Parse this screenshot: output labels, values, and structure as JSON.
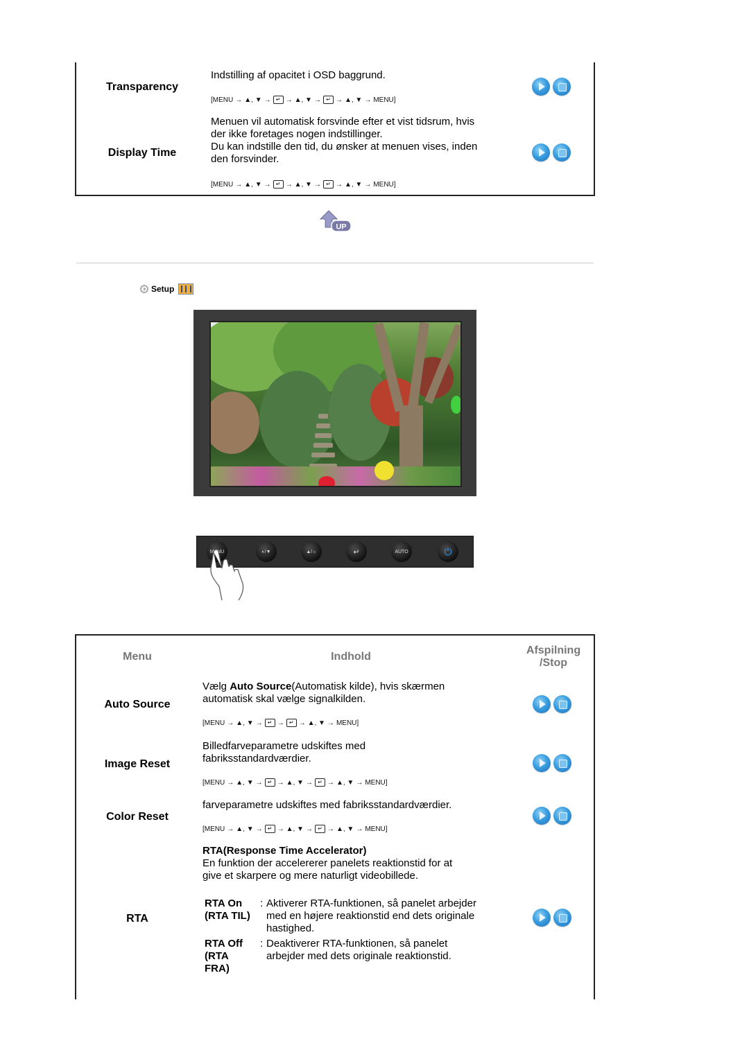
{
  "top_table": {
    "rows": [
      {
        "menu": "Transparency",
        "description": [
          "Indstilling af opacitet i OSD baggrund."
        ],
        "path": [
          "[MENU",
          "→",
          "▲, ▼",
          "→",
          "ENTER",
          "→",
          "▲, ▼",
          "→",
          "ENTER",
          "→",
          "▲, ▼",
          "→",
          "MENU]"
        ],
        "play_icon": "play-icon",
        "stop_icon": "stop-icon"
      },
      {
        "menu": "Display Time",
        "description": [
          "Menuen vil automatisk forsvinde efter et vist tidsrum, hvis",
          "der ikke foretages nogen indstillinger.",
          "Du kan indstille den tid, du ønsker at menuen vises, inden",
          "den forsvinder."
        ],
        "path": [
          "[MENU",
          "→",
          "▲, ▼",
          "→",
          "ENTER",
          "→",
          "▲, ▼",
          "→",
          "ENTER",
          "→",
          "▲, ▼",
          "→",
          "MENU]"
        ],
        "play_icon": "play-icon",
        "stop_icon": "stop-icon"
      }
    ]
  },
  "up_button": {
    "label": "UP",
    "icon": "up-arrow-icon"
  },
  "section": {
    "title": "Setup",
    "bullet_icon": "circle-arrow-icon",
    "section_icon": "equalizer-icon"
  },
  "monitor": {
    "image_alt": "garden-photo-with-pagoda"
  },
  "control_bar": {
    "buttons": [
      {
        "name": "menu",
        "label": "MENU"
      },
      {
        "name": "magic-down",
        "label": "◐/▼"
      },
      {
        "name": "up-brightness",
        "label": "▲/☼"
      },
      {
        "name": "enter",
        "label": "↵"
      },
      {
        "name": "auto",
        "label": "AUTO"
      },
      {
        "name": "power",
        "label": "⏻"
      }
    ]
  },
  "bottom_table": {
    "headers": {
      "menu": "Menu",
      "content": "Indhold",
      "playstop": "Afspilning /Stop",
      "playstop_l1": "Afspilning",
      "playstop_l2": "/Stop"
    },
    "rows": [
      {
        "menu": "Auto Source",
        "desc_prefix": "Vælg ",
        "desc_bold": "Auto Source",
        "desc_suffix": "(Automatisk kilde), hvis skærmen",
        "desc_line2": "automatisk skal vælge signalkilden.",
        "path": [
          "[MENU",
          "→",
          "▲, ▼",
          "→",
          "ENTER",
          "→",
          "ENTER",
          "→",
          "▲, ▼",
          "→",
          "MENU]"
        ]
      },
      {
        "menu": "Image Reset",
        "description": [
          "Billedfarveparametre udskiftes med",
          "fabriksstandardværdier."
        ],
        "path": [
          "[MENU",
          "→",
          "▲, ▼",
          "→",
          "ENTER",
          "→",
          "▲, ▼",
          "→",
          "ENTER",
          "→",
          "▲, ▼",
          "→",
          "MENU]"
        ]
      },
      {
        "menu": "Color Reset",
        "description": [
          "farveparametre udskiftes med fabriksstandardværdier."
        ],
        "path": [
          "[MENU",
          "→",
          "▲, ▼",
          "→",
          "ENTER",
          "→",
          "▲, ▼",
          "→",
          "ENTER",
          "→",
          "▲, ▼",
          "→",
          "MENU]"
        ]
      },
      {
        "menu": "RTA",
        "title": "RTA(Response Time Accelerator)",
        "description": [
          "En funktion der accelererer panelets reaktionstid for at",
          "give et skarpere og mere naturligt videobillede."
        ],
        "options": [
          {
            "key_lines": [
              "RTA On",
              "(RTA TIL)"
            ],
            "value_lines": [
              "Aktiverer RTA-funktionen, så panelet arbejder",
              "med en højere reaktionstid end dets originale",
              "hastighed."
            ]
          },
          {
            "key_lines": [
              "RTA Off",
              "(RTA",
              "FRA)"
            ],
            "value_lines": [
              "Deaktiverer RTA-funktionen, så panelet",
              "arbejder med dets originale reaktionstid."
            ]
          }
        ]
      }
    ]
  },
  "colors": {
    "border": "#222222",
    "header_gray": "#777777",
    "button_blue": "#3a9ee0",
    "divider": "#cfcfcf"
  }
}
